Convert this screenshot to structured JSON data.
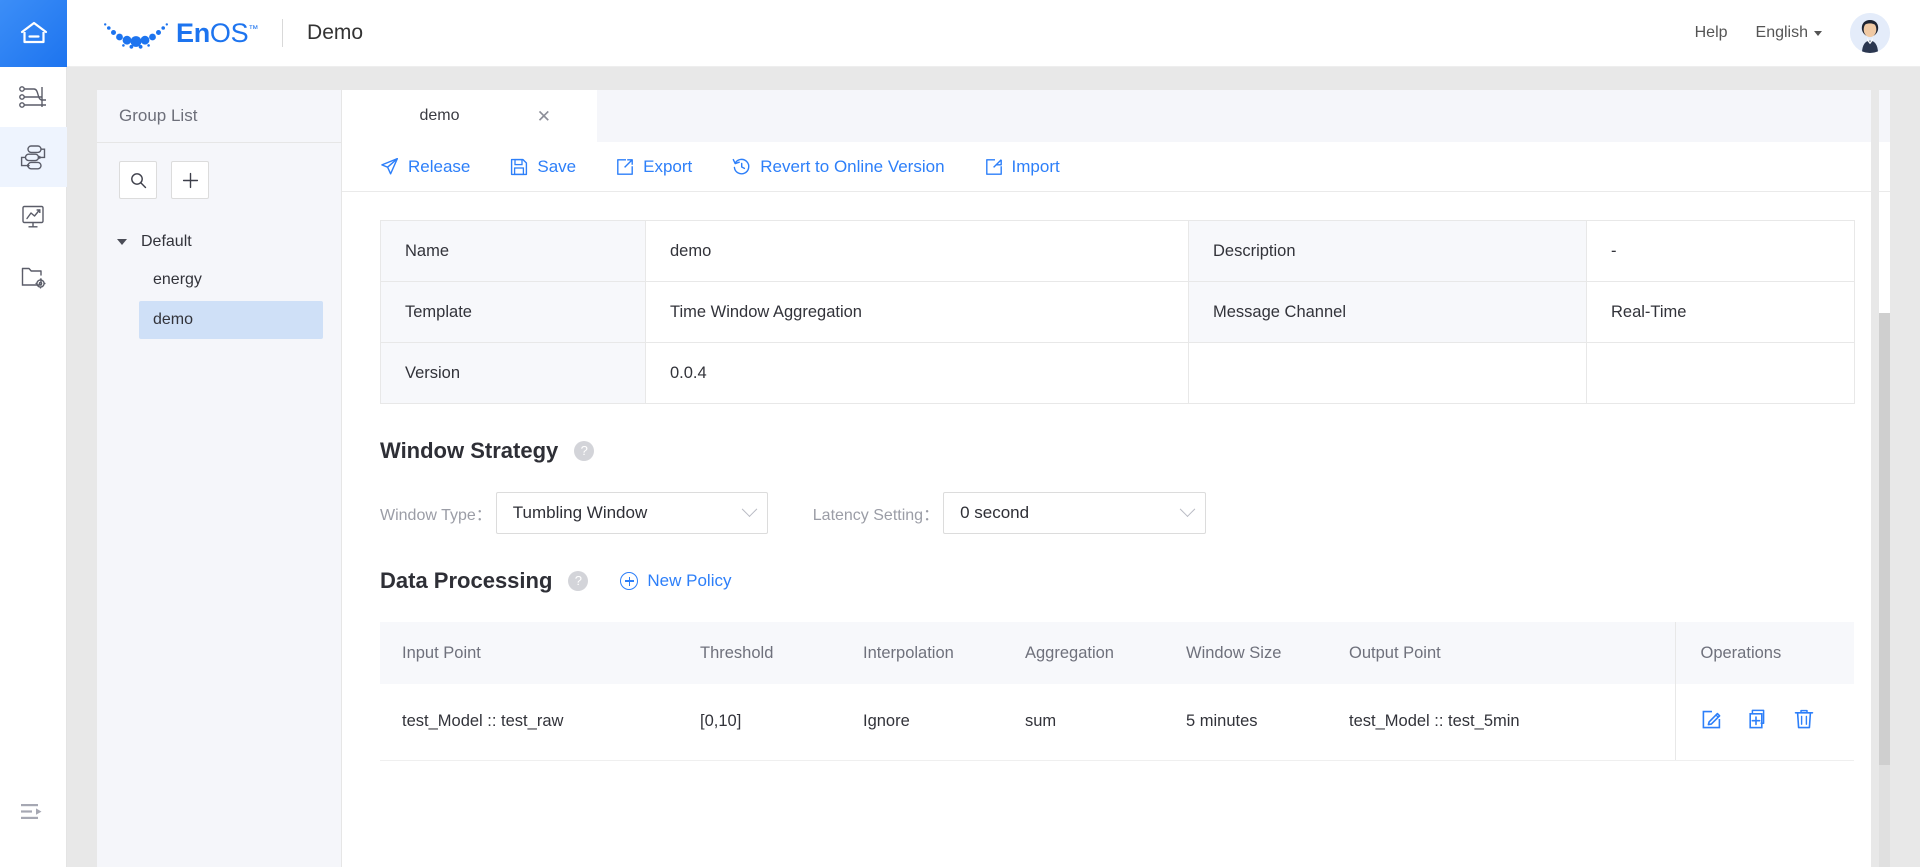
{
  "header": {
    "home_icon": "home-icon",
    "brand_name_bold": "En",
    "brand_name_light": "OS",
    "brand_tm": "™",
    "app_title": "Demo",
    "help_label": "Help",
    "language_label": "English",
    "avatar_alt": "user-avatar"
  },
  "rail": {
    "items": [
      {
        "icon": "pipeline-icon",
        "name": "data-pipeline",
        "active": false
      },
      {
        "icon": "stream-flow-icon",
        "name": "stream-processing",
        "active": true
      },
      {
        "icon": "chart-monitor-icon",
        "name": "analytics",
        "active": false
      },
      {
        "icon": "folder-settings-icon",
        "name": "storage-settings",
        "active": false
      }
    ],
    "collapse_icon": "collapse-panel-icon"
  },
  "group_panel": {
    "title": "Group List",
    "search_icon": "search-icon",
    "add_icon": "plus-icon",
    "tree": {
      "root_label": "Default",
      "children": [
        {
          "label": "energy",
          "selected": false
        },
        {
          "label": "demo",
          "selected": true
        }
      ]
    }
  },
  "tabs": [
    {
      "label": "demo",
      "close_icon": "close-icon",
      "active": true
    }
  ],
  "toolbar": [
    {
      "label": "Release",
      "icon": "send-icon"
    },
    {
      "label": "Save",
      "icon": "floppy-disk-icon"
    },
    {
      "label": "Export",
      "icon": "export-icon"
    },
    {
      "label": "Revert to Online Version",
      "icon": "revert-clock-icon"
    },
    {
      "label": "Import",
      "icon": "import-icon"
    }
  ],
  "info": {
    "rows": [
      {
        "l1": "Name",
        "v1": "demo",
        "l2": "Description",
        "v2": "-"
      },
      {
        "l1": "Template",
        "v1": "Time Window Aggregation",
        "l2": "Message Channel",
        "v2": "Real-Time"
      },
      {
        "l1": "Version",
        "v1": "0.0.4",
        "l2": "",
        "v2": ""
      }
    ]
  },
  "window_strategy": {
    "title": "Window Strategy",
    "help_icon": "question-mark-icon",
    "window_type_label": "Window Type：",
    "window_type_value": "Tumbling Window",
    "latency_label": "Latency Setting：",
    "latency_value": "0 second",
    "chevron_icon": "chevron-down-icon"
  },
  "data_processing": {
    "title": "Data Processing",
    "help_icon": "question-mark-icon",
    "new_policy_label": "New Policy",
    "new_policy_icon": "plus-circle-icon",
    "columns": [
      "Input Point",
      "Threshold",
      "Interpolation",
      "Aggregation",
      "Window Size",
      "Output Point",
      "Operations"
    ],
    "rows": [
      {
        "input_point": "test_Model :: test_raw",
        "threshold": "[0,10]",
        "interpolation": "Ignore",
        "aggregation": "sum",
        "window_size": "5 minutes",
        "output_point": "test_Model :: test_5min",
        "operations": [
          {
            "icon": "edit-pencil-icon",
            "name": "edit-row-button"
          },
          {
            "icon": "duplicate-icon",
            "name": "duplicate-row-button"
          },
          {
            "icon": "trash-icon",
            "name": "delete-row-button"
          }
        ]
      }
    ]
  },
  "colors": {
    "accent": "#2d7ff9",
    "brand": "#1d74ef",
    "selected_row": "#cfe0f7",
    "panel_bg": "#f5f6fa",
    "table_header_bg": "#f7f8fb"
  }
}
